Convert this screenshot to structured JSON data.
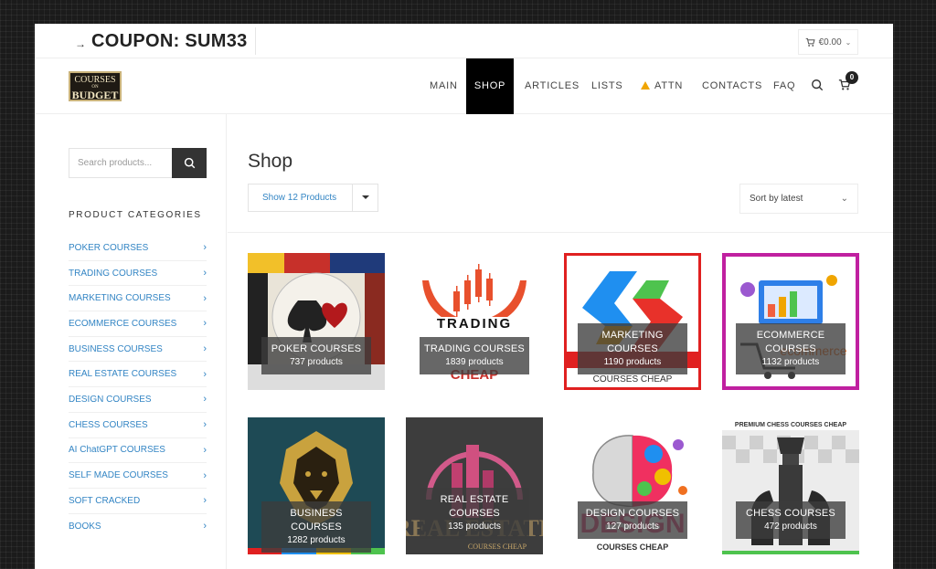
{
  "topbar": {
    "coupon": "COUPON: SUM33",
    "cart_total": "€0.00"
  },
  "logo": {
    "line1": "COURSES",
    "line2": "ON",
    "line3": "BUDGET"
  },
  "nav": {
    "items": [
      "MAIN",
      "SHOP",
      "ARTICLES",
      "LISTS",
      "ATTN",
      "CONTACTS",
      "FAQ"
    ],
    "active": "SHOP",
    "cart_count": "0"
  },
  "sidebar": {
    "search_placeholder": "Search products...",
    "categories_title": "PRODUCT CATEGORIES",
    "categories": [
      "POKER COURSES",
      "TRADING COURSES",
      "MARKETING COURSES",
      "ECOMMERCE COURSES",
      "BUSINESS COURSES",
      "REAL ESTATE COURSES",
      "DESIGN COURSES",
      "CHESS COURSES",
      "AI ChatGPT COURSES",
      "SELF MADE COURSES",
      "SOFT CRACKED",
      "BOOKS"
    ]
  },
  "main": {
    "title": "Shop",
    "show_select": "Show 12 Products",
    "sort_select": "Sort by latest",
    "products": [
      {
        "name": "POKER COURSES",
        "count": "737 products"
      },
      {
        "name": "TRADING COURSES",
        "count": "1839 products"
      },
      {
        "name": "MARKETING COURSES",
        "count": "1190 products"
      },
      {
        "name": "ECOMMERCE COURSES",
        "count": "1132 products"
      },
      {
        "name": "BUSINESS COURSES",
        "count": "1282 products"
      },
      {
        "name": "REAL ESTATE COURSES",
        "count": "135 products"
      },
      {
        "name": "DESIGN COURSES",
        "count": "127 products"
      },
      {
        "name": "CHESS COURSES",
        "count": "472 products"
      }
    ]
  },
  "colors": {
    "link": "#3385c4",
    "active_nav_bg": "#000000",
    "dark": "#333333"
  },
  "icons": [
    "arrow-right-icon",
    "cart-icon",
    "chevron-down-icon",
    "search-icon",
    "warning-icon",
    "chevron-right-icon"
  ]
}
